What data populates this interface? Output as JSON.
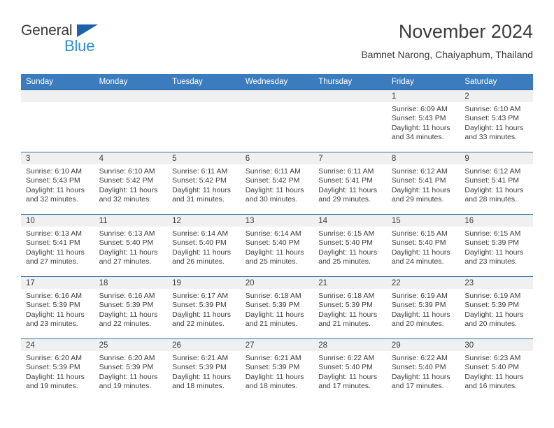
{
  "brand": {
    "name_top": "General",
    "name_bottom": "Blue",
    "triangle_color": "#1b62ab",
    "blue_color": "#2e8bd6"
  },
  "header": {
    "title": "November 2024",
    "subtitle": "Bamnet Narong, Chaiyaphum, Thailand"
  },
  "theme": {
    "header_bg": "#3a7cbe",
    "row_divider": "#2f6da8",
    "daynum_bg": "#f0f0f0",
    "text": "#3c3c3c"
  },
  "weekdays": [
    "Sunday",
    "Monday",
    "Tuesday",
    "Wednesday",
    "Thursday",
    "Friday",
    "Saturday"
  ],
  "labels": {
    "sunrise_prefix": "Sunrise:",
    "sunset_prefix": "Sunset:",
    "daylight_prefix": "Daylight:"
  },
  "weeks": [
    [
      {
        "day": ""
      },
      {
        "day": ""
      },
      {
        "day": ""
      },
      {
        "day": ""
      },
      {
        "day": ""
      },
      {
        "day": "1",
        "sunrise": "Sunrise: 6:09 AM",
        "sunset": "Sunset: 5:43 PM",
        "daylight": "Daylight: 11 hours and 34 minutes."
      },
      {
        "day": "2",
        "sunrise": "Sunrise: 6:10 AM",
        "sunset": "Sunset: 5:43 PM",
        "daylight": "Daylight: 11 hours and 33 minutes."
      }
    ],
    [
      {
        "day": "3",
        "sunrise": "Sunrise: 6:10 AM",
        "sunset": "Sunset: 5:43 PM",
        "daylight": "Daylight: 11 hours and 32 minutes."
      },
      {
        "day": "4",
        "sunrise": "Sunrise: 6:10 AM",
        "sunset": "Sunset: 5:42 PM",
        "daylight": "Daylight: 11 hours and 32 minutes."
      },
      {
        "day": "5",
        "sunrise": "Sunrise: 6:11 AM",
        "sunset": "Sunset: 5:42 PM",
        "daylight": "Daylight: 11 hours and 31 minutes."
      },
      {
        "day": "6",
        "sunrise": "Sunrise: 6:11 AM",
        "sunset": "Sunset: 5:42 PM",
        "daylight": "Daylight: 11 hours and 30 minutes."
      },
      {
        "day": "7",
        "sunrise": "Sunrise: 6:11 AM",
        "sunset": "Sunset: 5:41 PM",
        "daylight": "Daylight: 11 hours and 29 minutes."
      },
      {
        "day": "8",
        "sunrise": "Sunrise: 6:12 AM",
        "sunset": "Sunset: 5:41 PM",
        "daylight": "Daylight: 11 hours and 29 minutes."
      },
      {
        "day": "9",
        "sunrise": "Sunrise: 6:12 AM",
        "sunset": "Sunset: 5:41 PM",
        "daylight": "Daylight: 11 hours and 28 minutes."
      }
    ],
    [
      {
        "day": "10",
        "sunrise": "Sunrise: 6:13 AM",
        "sunset": "Sunset: 5:41 PM",
        "daylight": "Daylight: 11 hours and 27 minutes."
      },
      {
        "day": "11",
        "sunrise": "Sunrise: 6:13 AM",
        "sunset": "Sunset: 5:40 PM",
        "daylight": "Daylight: 11 hours and 27 minutes."
      },
      {
        "day": "12",
        "sunrise": "Sunrise: 6:14 AM",
        "sunset": "Sunset: 5:40 PM",
        "daylight": "Daylight: 11 hours and 26 minutes."
      },
      {
        "day": "13",
        "sunrise": "Sunrise: 6:14 AM",
        "sunset": "Sunset: 5:40 PM",
        "daylight": "Daylight: 11 hours and 25 minutes."
      },
      {
        "day": "14",
        "sunrise": "Sunrise: 6:15 AM",
        "sunset": "Sunset: 5:40 PM",
        "daylight": "Daylight: 11 hours and 25 minutes."
      },
      {
        "day": "15",
        "sunrise": "Sunrise: 6:15 AM",
        "sunset": "Sunset: 5:40 PM",
        "daylight": "Daylight: 11 hours and 24 minutes."
      },
      {
        "day": "16",
        "sunrise": "Sunrise: 6:15 AM",
        "sunset": "Sunset: 5:39 PM",
        "daylight": "Daylight: 11 hours and 23 minutes."
      }
    ],
    [
      {
        "day": "17",
        "sunrise": "Sunrise: 6:16 AM",
        "sunset": "Sunset: 5:39 PM",
        "daylight": "Daylight: 11 hours and 23 minutes."
      },
      {
        "day": "18",
        "sunrise": "Sunrise: 6:16 AM",
        "sunset": "Sunset: 5:39 PM",
        "daylight": "Daylight: 11 hours and 22 minutes."
      },
      {
        "day": "19",
        "sunrise": "Sunrise: 6:17 AM",
        "sunset": "Sunset: 5:39 PM",
        "daylight": "Daylight: 11 hours and 22 minutes."
      },
      {
        "day": "20",
        "sunrise": "Sunrise: 6:18 AM",
        "sunset": "Sunset: 5:39 PM",
        "daylight": "Daylight: 11 hours and 21 minutes."
      },
      {
        "day": "21",
        "sunrise": "Sunrise: 6:18 AM",
        "sunset": "Sunset: 5:39 PM",
        "daylight": "Daylight: 11 hours and 21 minutes."
      },
      {
        "day": "22",
        "sunrise": "Sunrise: 6:19 AM",
        "sunset": "Sunset: 5:39 PM",
        "daylight": "Daylight: 11 hours and 20 minutes."
      },
      {
        "day": "23",
        "sunrise": "Sunrise: 6:19 AM",
        "sunset": "Sunset: 5:39 PM",
        "daylight": "Daylight: 11 hours and 20 minutes."
      }
    ],
    [
      {
        "day": "24",
        "sunrise": "Sunrise: 6:20 AM",
        "sunset": "Sunset: 5:39 PM",
        "daylight": "Daylight: 11 hours and 19 minutes."
      },
      {
        "day": "25",
        "sunrise": "Sunrise: 6:20 AM",
        "sunset": "Sunset: 5:39 PM",
        "daylight": "Daylight: 11 hours and 19 minutes."
      },
      {
        "day": "26",
        "sunrise": "Sunrise: 6:21 AM",
        "sunset": "Sunset: 5:39 PM",
        "daylight": "Daylight: 11 hours and 18 minutes."
      },
      {
        "day": "27",
        "sunrise": "Sunrise: 6:21 AM",
        "sunset": "Sunset: 5:39 PM",
        "daylight": "Daylight: 11 hours and 18 minutes."
      },
      {
        "day": "28",
        "sunrise": "Sunrise: 6:22 AM",
        "sunset": "Sunset: 5:40 PM",
        "daylight": "Daylight: 11 hours and 17 minutes."
      },
      {
        "day": "29",
        "sunrise": "Sunrise: 6:22 AM",
        "sunset": "Sunset: 5:40 PM",
        "daylight": "Daylight: 11 hours and 17 minutes."
      },
      {
        "day": "30",
        "sunrise": "Sunrise: 6:23 AM",
        "sunset": "Sunset: 5:40 PM",
        "daylight": "Daylight: 11 hours and 16 minutes."
      }
    ]
  ]
}
